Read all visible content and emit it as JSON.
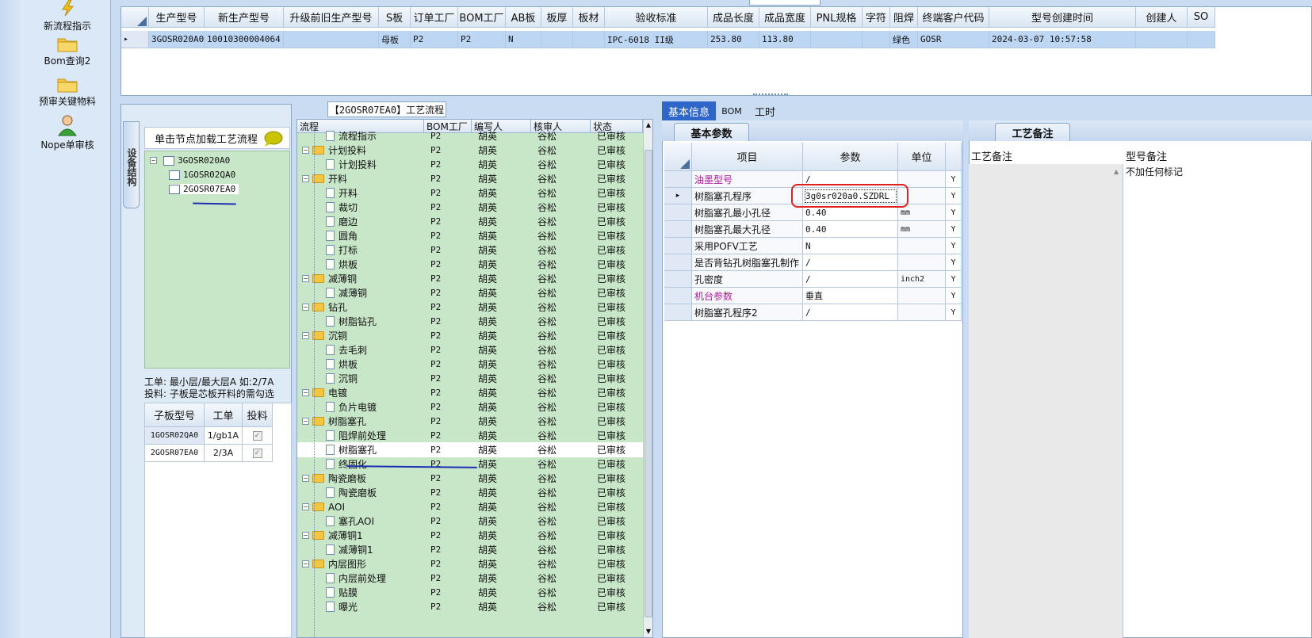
{
  "nav": {
    "items": [
      {
        "label": "新流程指示",
        "icon": "lightning-icon"
      },
      {
        "label": "Bom查询2",
        "icon": "folder-icon"
      },
      {
        "label": "预审关键物料",
        "icon": "folder-icon"
      },
      {
        "label": "Nope单审核",
        "icon": "user-icon"
      }
    ]
  },
  "top_grid": {
    "headers": [
      "生产型号",
      "新生产型号",
      "升级前旧生产型号",
      "S板",
      "订单工厂",
      "BOM工厂",
      "AB板",
      "板厚",
      "板材",
      "验收标准",
      "成品长度",
      "成品宽度",
      "PNL规格",
      "字符",
      "阻焊",
      "终端客户代码",
      "型号创建时间",
      "创建人",
      "SO"
    ],
    "row": [
      "3GOSR020A0",
      "10010300004064",
      "",
      "母板",
      "P2",
      "P2",
      "N",
      "",
      "",
      "IPC-6018 II级",
      "253.80",
      "113.80",
      "",
      "",
      "绿色",
      "GOSR",
      "2024-03-07 10:57:58",
      "",
      ""
    ]
  },
  "tree_panel": {
    "side_tab": "设备结构",
    "hint": "单击节点加载工艺流程",
    "nodes": [
      "3GOSR020A0",
      "1GOSR02QA0",
      "2GOSR07EA0"
    ],
    "note_line1": "工单: 最小层/最大层A 如:2/7A",
    "note_line2": "投料: 子板是芯板开料的需勾选"
  },
  "sub_grid": {
    "headers": [
      "子板型号",
      "工单",
      "投料"
    ],
    "rows": [
      {
        "model": "1GOSR02QA0",
        "order": "1/gb1A",
        "check": "✓"
      },
      {
        "model": "2GOSR07EA0",
        "order": "2/3A",
        "check": "✓"
      }
    ]
  },
  "process": {
    "title": "【2GOSR07EA0】工艺流程",
    "headers": [
      "流程",
      "BOM工厂",
      "编写人",
      "核审人",
      "状态"
    ],
    "rows": [
      {
        "level": 2,
        "name": "流程指示",
        "bom": "P2",
        "writer": "胡英",
        "auditor": "谷松",
        "status": "已审核"
      },
      {
        "level": 1,
        "name": "计划投料",
        "bom": "P2",
        "writer": "胡英",
        "auditor": "谷松",
        "status": "已审核"
      },
      {
        "level": 2,
        "name": "计划投料",
        "bom": "P2",
        "writer": "胡英",
        "auditor": "谷松",
        "status": "已审核"
      },
      {
        "level": 1,
        "name": "开料",
        "bom": "P2",
        "writer": "胡英",
        "auditor": "谷松",
        "status": "已审核"
      },
      {
        "level": 2,
        "name": "开料",
        "bom": "P2",
        "writer": "胡英",
        "auditor": "谷松",
        "status": "已审核"
      },
      {
        "level": 2,
        "name": "裁切",
        "bom": "P2",
        "writer": "胡英",
        "auditor": "谷松",
        "status": "已审核"
      },
      {
        "level": 2,
        "name": "磨边",
        "bom": "P2",
        "writer": "胡英",
        "auditor": "谷松",
        "status": "已审核"
      },
      {
        "level": 2,
        "name": "圆角",
        "bom": "P2",
        "writer": "胡英",
        "auditor": "谷松",
        "status": "已审核"
      },
      {
        "level": 2,
        "name": "打标",
        "bom": "P2",
        "writer": "胡英",
        "auditor": "谷松",
        "status": "已审核"
      },
      {
        "level": 2,
        "name": "烘板",
        "bom": "P2",
        "writer": "胡英",
        "auditor": "谷松",
        "status": "已审核"
      },
      {
        "level": 1,
        "name": "减薄铜",
        "bom": "P2",
        "writer": "胡英",
        "auditor": "谷松",
        "status": "已审核"
      },
      {
        "level": 2,
        "name": "减薄铜",
        "bom": "P2",
        "writer": "胡英",
        "auditor": "谷松",
        "status": "已审核"
      },
      {
        "level": 1,
        "name": "钻孔",
        "bom": "P2",
        "writer": "胡英",
        "auditor": "谷松",
        "status": "已审核"
      },
      {
        "level": 2,
        "name": "树脂钻孔",
        "bom": "P2",
        "writer": "胡英",
        "auditor": "谷松",
        "status": "已审核"
      },
      {
        "level": 1,
        "name": "沉铜",
        "bom": "P2",
        "writer": "胡英",
        "auditor": "谷松",
        "status": "已审核"
      },
      {
        "level": 2,
        "name": "去毛刺",
        "bom": "P2",
        "writer": "胡英",
        "auditor": "谷松",
        "status": "已审核"
      },
      {
        "level": 2,
        "name": "烘板",
        "bom": "P2",
        "writer": "胡英",
        "auditor": "谷松",
        "status": "已审核"
      },
      {
        "level": 2,
        "name": "沉铜",
        "bom": "P2",
        "writer": "胡英",
        "auditor": "谷松",
        "status": "已审核"
      },
      {
        "level": 1,
        "name": "电镀",
        "bom": "P2",
        "writer": "胡英",
        "auditor": "谷松",
        "status": "已审核"
      },
      {
        "level": 2,
        "name": "负片电镀",
        "bom": "P2",
        "writer": "胡英",
        "auditor": "谷松",
        "status": "已审核"
      },
      {
        "level": 1,
        "name": "树脂塞孔",
        "bom": "P2",
        "writer": "胡英",
        "auditor": "谷松",
        "status": "已审核"
      },
      {
        "level": 2,
        "name": "阻焊前处理",
        "bom": "P2",
        "writer": "胡英",
        "auditor": "谷松",
        "status": "已审核"
      },
      {
        "level": 2,
        "name": "树脂塞孔",
        "bom": "P2",
        "writer": "胡英",
        "auditor": "谷松",
        "status": "已审核",
        "selected": true
      },
      {
        "level": 2,
        "name": "终固化",
        "bom": "P2",
        "writer": "胡英",
        "auditor": "谷松",
        "status": "已审核"
      },
      {
        "level": 1,
        "name": "陶瓷磨板",
        "bom": "P2",
        "writer": "胡英",
        "auditor": "谷松",
        "status": "已审核"
      },
      {
        "level": 2,
        "name": "陶瓷磨板",
        "bom": "P2",
        "writer": "胡英",
        "auditor": "谷松",
        "status": "已审核"
      },
      {
        "level": 1,
        "name": "AOI",
        "bom": "P2",
        "writer": "胡英",
        "auditor": "谷松",
        "status": "已审核"
      },
      {
        "level": 2,
        "name": "塞孔AOI",
        "bom": "P2",
        "writer": "胡英",
        "auditor": "谷松",
        "status": "已审核"
      },
      {
        "level": 1,
        "name": "减薄铜1",
        "bom": "P2",
        "writer": "胡英",
        "auditor": "谷松",
        "status": "已审核"
      },
      {
        "level": 2,
        "name": "减薄铜1",
        "bom": "P2",
        "writer": "胡英",
        "auditor": "谷松",
        "status": "已审核"
      },
      {
        "level": 1,
        "name": "内层图形",
        "bom": "P2",
        "writer": "胡英",
        "auditor": "谷松",
        "status": "已审核"
      },
      {
        "level": 2,
        "name": "内层前处理",
        "bom": "P2",
        "writer": "胡英",
        "auditor": "谷松",
        "status": "已审核"
      },
      {
        "level": 2,
        "name": "贴膜",
        "bom": "P2",
        "writer": "胡英",
        "auditor": "谷松",
        "status": "已审核"
      },
      {
        "level": 2,
        "name": "曝光",
        "bom": "P2",
        "writer": "胡英",
        "auditor": "谷松",
        "status": "已审核"
      }
    ]
  },
  "tabs": {
    "basic": "基本信息",
    "bom": "BOM",
    "hours": "工时"
  },
  "basic_params": {
    "tab_label": "基本参数",
    "headers": [
      "项目",
      "参数",
      "单位"
    ],
    "rows": [
      {
        "item": "油墨型号",
        "value": "/",
        "unit": "",
        "flag": "Y",
        "accent": true
      },
      {
        "item": "树脂塞孔程序",
        "value": "3g0sr020a0.SZDRL",
        "unit": "",
        "flag": "Y",
        "current": true
      },
      {
        "item": "树脂塞孔最小孔径",
        "value": "0.40",
        "unit": "mm",
        "flag": "Y"
      },
      {
        "item": "树脂塞孔最大孔径",
        "value": "0.40",
        "unit": "mm",
        "flag": "Y"
      },
      {
        "item": "采用POFV工艺",
        "value": "N",
        "unit": "",
        "flag": "Y"
      },
      {
        "item": "是否背钻孔树脂塞孔制作",
        "value": "/",
        "unit": "",
        "flag": "Y"
      },
      {
        "item": "孔密度",
        "value": "/",
        "unit": "inch2",
        "flag": "Y"
      },
      {
        "item": "机台参数",
        "value": "垂直",
        "unit": "",
        "flag": "Y",
        "accent": true
      },
      {
        "item": "树脂塞孔程序2",
        "value": "/",
        "unit": "",
        "flag": "Y"
      }
    ]
  },
  "remarks": {
    "tab_label": "工艺备注",
    "col1": "工艺备注",
    "col2": "型号备注",
    "model_remark": "不加任何标记"
  },
  "colors": {
    "accent_text": "#b0189a",
    "highlight_ring": "#e0201c",
    "ink": "#1b2fb3",
    "tree_bg": "#c8e6c8",
    "tab_active": "#2f66c9"
  }
}
